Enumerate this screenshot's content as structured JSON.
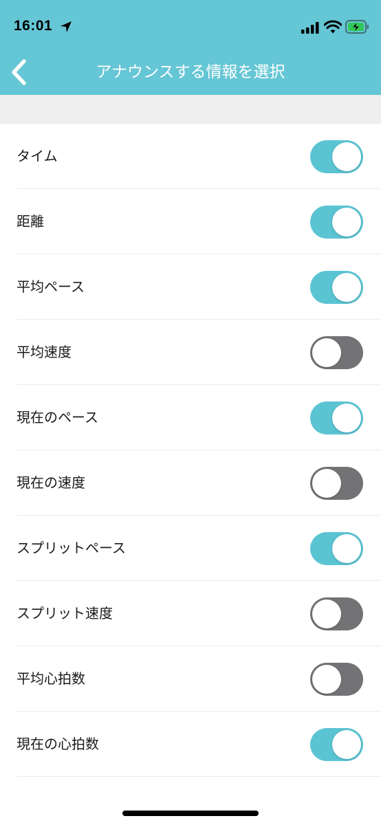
{
  "status_bar": {
    "time": "16:01",
    "icons": [
      "location-arrow-icon",
      "cellular-signal-icon",
      "wifi-icon",
      "battery-charging-icon"
    ]
  },
  "nav": {
    "title": "アナウンスする情報を選択",
    "back_icon": "chevron-left-icon"
  },
  "colors": {
    "header_bg": "#65c6d5",
    "toggle_on": "#5bc4d3",
    "toggle_off": "#737375",
    "section_band": "#efefef"
  },
  "settings": [
    {
      "label": "タイム",
      "enabled": true
    },
    {
      "label": "距離",
      "enabled": true
    },
    {
      "label": "平均ペース",
      "enabled": true
    },
    {
      "label": "平均速度",
      "enabled": false
    },
    {
      "label": "現在のペース",
      "enabled": true
    },
    {
      "label": "現在の速度",
      "enabled": false
    },
    {
      "label": "スプリットペース",
      "enabled": true
    },
    {
      "label": "スプリット速度",
      "enabled": false
    },
    {
      "label": "平均心拍数",
      "enabled": false
    },
    {
      "label": "現在の心拍数",
      "enabled": true
    }
  ]
}
